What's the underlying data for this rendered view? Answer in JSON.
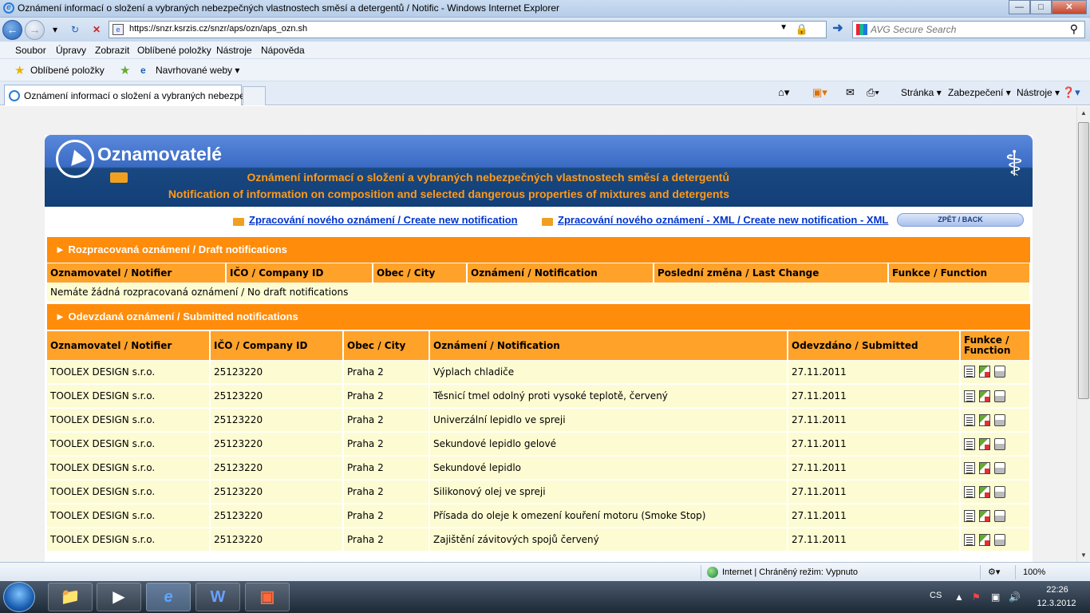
{
  "window": {
    "title": "Oznámení informací o složení a vybraných nebezpečných vlastnostech směsí a detergentů / Notific - Windows Internet Explorer",
    "min_label": "—",
    "max_label": "□",
    "close_label": "✕"
  },
  "address": {
    "url": "https://snzr.ksrzis.cz/snzr/aps/ozn/aps_ozn.sh",
    "search_placeholder": "AVG Secure Search"
  },
  "menu": [
    "Soubor",
    "Úpravy",
    "Zobrazit",
    "Oblíbené položky",
    "Nástroje",
    "Nápověda"
  ],
  "favorites": {
    "favorites_label": "Oblíbené položky",
    "suggested_label": "Navrhované weby ▾"
  },
  "tab": {
    "title": "Oznámení informací o složení a vybraných nebezpečn..."
  },
  "commandbar": {
    "page": "Stránka ▾",
    "safety": "Zabezpečení ▾",
    "tools": "Nástroje ▾"
  },
  "app": {
    "title": "Oznamovatelé",
    "subtitle_cz": "Oznámení informací o složení a vybraných nebezpečných vlastnostech směsí a detergentů",
    "subtitle_en": "Notification of information on composition and selected dangerous properties of mixtures and detergents",
    "link_new": "Zpracování nového oznámení / Create new notification",
    "link_new_xml": "Zpracování nového oznámení - XML / Create new notification - XML",
    "back_label": "ZPĚT / BACK"
  },
  "drafts": {
    "heading": "► Rozpracovaná oznámení / Draft notifications",
    "columns": [
      "Oznamovatel / Notifier",
      "IČO / Company ID",
      "Obec / City",
      "Oznámení / Notification",
      "Poslední změna / Last Change",
      "Funkce / Function"
    ],
    "empty_text": "Nemáte žádná rozpracovaná oznámení / No draft notifications"
  },
  "submitted": {
    "heading": "► Odevzdaná oznámení / Submitted notifications",
    "columns": [
      "Oznamovatel / Notifier",
      "IČO / Company ID",
      "Obec / City",
      "Oznámení / Notification",
      "Odevzdáno / Submitted",
      "Funkce / Function"
    ],
    "rows": [
      {
        "notifier": "TOOLEX DESIGN s.r.o.",
        "ico": "25123220",
        "city": "Praha 2",
        "notification": "Výplach chladiče",
        "submitted": "27.11.2011"
      },
      {
        "notifier": "TOOLEX DESIGN s.r.o.",
        "ico": "25123220",
        "city": "Praha 2",
        "notification": "Těsnicí tmel odolný proti vysoké teplotě, červený",
        "submitted": "27.11.2011"
      },
      {
        "notifier": "TOOLEX DESIGN s.r.o.",
        "ico": "25123220",
        "city": "Praha 2",
        "notification": "Univerzální lepidlo ve spreji",
        "submitted": "27.11.2011"
      },
      {
        "notifier": "TOOLEX DESIGN s.r.o.",
        "ico": "25123220",
        "city": "Praha 2",
        "notification": "Sekundové lepidlo gelové",
        "submitted": "27.11.2011"
      },
      {
        "notifier": "TOOLEX DESIGN s.r.o.",
        "ico": "25123220",
        "city": "Praha 2",
        "notification": "Sekundové lepidlo",
        "submitted": "27.11.2011"
      },
      {
        "notifier": "TOOLEX DESIGN s.r.o.",
        "ico": "25123220",
        "city": "Praha 2",
        "notification": "Silikonový olej ve spreji",
        "submitted": "27.11.2011"
      },
      {
        "notifier": "TOOLEX DESIGN s.r.o.",
        "ico": "25123220",
        "city": "Praha 2",
        "notification": "Přísada do oleje k omezení kouření motoru (Smoke Stop)",
        "submitted": "27.11.2011"
      },
      {
        "notifier": "TOOLEX DESIGN s.r.o.",
        "ico": "25123220",
        "city": "Praha 2",
        "notification": "Zajištění závitových spojů červený",
        "submitted": "27.11.2011"
      }
    ],
    "row_icons": [
      "document-icon",
      "copy-icon",
      "print-icon"
    ]
  },
  "status": {
    "zone": "Internet | Chráněný režim: Vypnuto",
    "zoom": "100%"
  },
  "taskbar": {
    "lang": "CS",
    "time": "22:26",
    "date": "12.3.2012"
  }
}
